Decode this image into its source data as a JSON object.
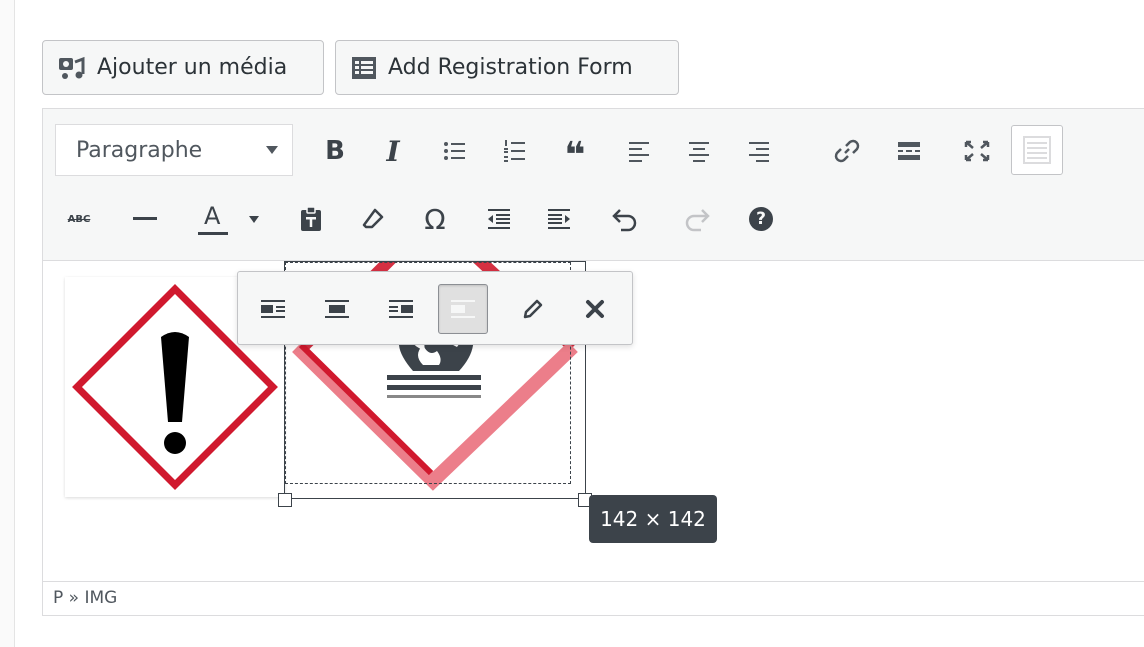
{
  "media_buttons": {
    "add_media": "Ajouter un média",
    "add_registration_form": "Add Registration Form"
  },
  "toolbar": {
    "format_select": "Paragraphe",
    "row1_icons": [
      "bold-icon",
      "italic-icon",
      "bullet-list-icon",
      "numbered-list-icon",
      "blockquote-icon",
      "align-left-icon",
      "align-center-icon",
      "align-right-icon",
      "link-icon",
      "read-more-icon",
      "fullscreen-icon",
      "toolbar-toggle-icon"
    ],
    "row2_icons": [
      "strikethrough-icon",
      "horizontal-line-icon",
      "text-color-icon",
      "paste-text-icon",
      "clear-formatting-icon",
      "special-character-icon",
      "outdent-icon",
      "indent-icon",
      "undo-icon",
      "redo-icon",
      "help-icon"
    ],
    "bold_glyph": "B",
    "italic_glyph": "I",
    "quote_glyph": "❝",
    "omega_glyph": "Ω",
    "abc_glyph": "ABC",
    "text_color_glyph": "A",
    "help_glyph": "?"
  },
  "image_toolbar": {
    "icons": [
      "align-left-icon",
      "align-center-icon",
      "align-right-icon",
      "no-align-icon",
      "edit-icon",
      "remove-icon"
    ],
    "active": "no-align-icon"
  },
  "selection": {
    "size_tooltip": "142 × 142"
  },
  "statusbar": {
    "path": "P » IMG"
  },
  "colors": {
    "hazard_red": "#d0192e",
    "toolbar_bg": "#f6f7f7",
    "tooltip_bg": "#3c434a"
  }
}
